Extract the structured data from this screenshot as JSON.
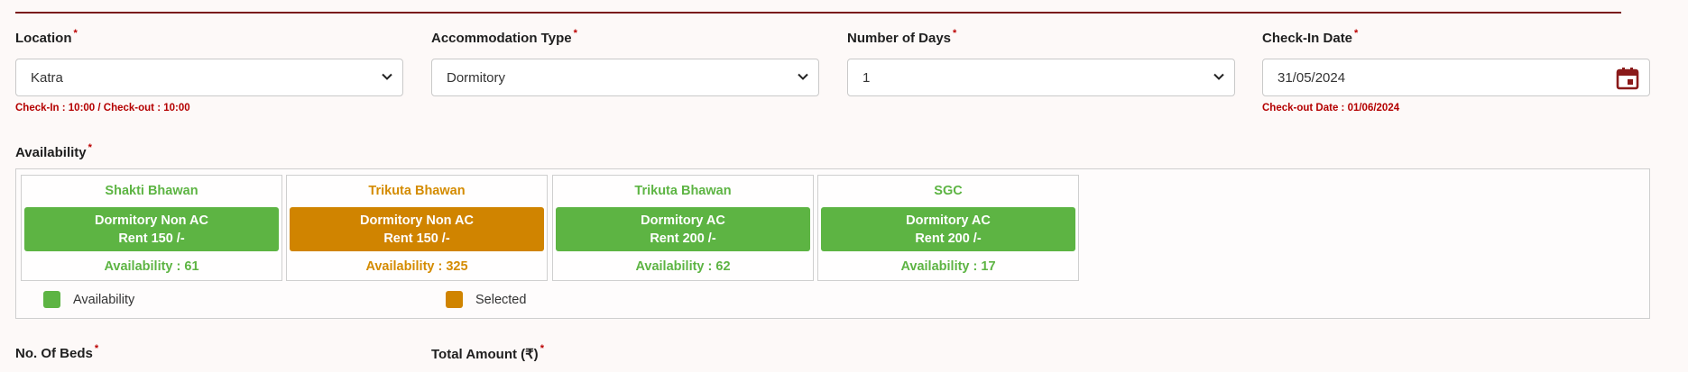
{
  "fields": {
    "location": {
      "label": "Location",
      "required": "*",
      "value": "Katra",
      "note": "Check-In : 10:00 / Check-out : 10:00"
    },
    "accommodation": {
      "label": "Accommodation Type",
      "required": "*",
      "value": "Dormitory"
    },
    "days": {
      "label": "Number of Days",
      "required": "*",
      "value": "1"
    },
    "checkin": {
      "label": "Check-In Date",
      "required": "*",
      "value": "31/05/2024",
      "note": "Check-out Date : 01/06/2024"
    }
  },
  "availability": {
    "label": "Availability",
    "required": "*",
    "cards": [
      {
        "name": "Shakti Bhawan",
        "type": "Dormitory Non AC",
        "rent": "Rent 150 /-",
        "availability": "Availability : 61",
        "state": "available"
      },
      {
        "name": "Trikuta Bhawan",
        "type": "Dormitory Non AC",
        "rent": "Rent 150 /-",
        "availability": "Availability : 325",
        "state": "selected"
      },
      {
        "name": "Trikuta Bhawan",
        "type": "Dormitory AC",
        "rent": "Rent 200 /-",
        "availability": "Availability : 62",
        "state": "available"
      },
      {
        "name": "SGC",
        "type": "Dormitory AC",
        "rent": "Rent 200 /-",
        "availability": "Availability : 17",
        "state": "available"
      }
    ],
    "legend": {
      "available": "Availability",
      "selected": "Selected"
    }
  },
  "bottom": {
    "beds_label": "No. Of Beds",
    "amount_label": "Total Amount (₹)",
    "required": "*"
  },
  "colors": {
    "available": "#5db443",
    "selected": "#d08400",
    "note": "#b40000",
    "accent_line": "#7a1c1c"
  },
  "icons": {
    "select": "chevron-down-icon",
    "date": "calendar-icon"
  }
}
